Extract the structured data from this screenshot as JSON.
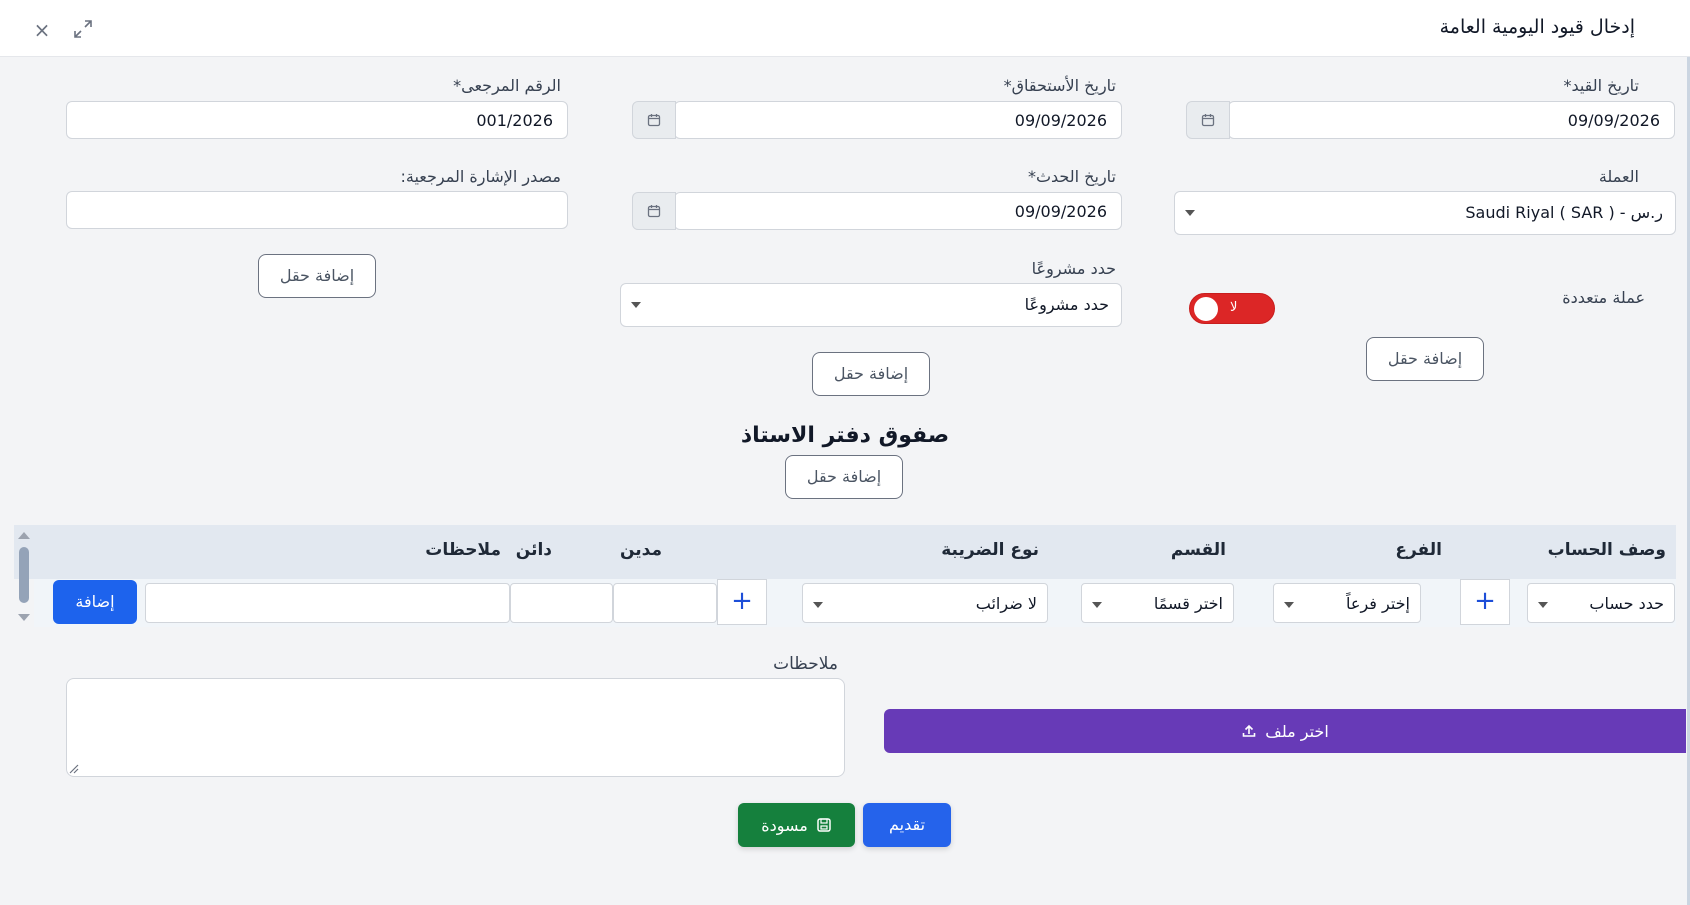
{
  "header": {
    "title": "إدخال قيود اليومية العامة"
  },
  "form": {
    "entry_date": {
      "label": "تاريخ القيد*",
      "value": "09/09/2026"
    },
    "due_date": {
      "label": "تاريخ الأستحقاق*",
      "value": "09/09/2026"
    },
    "reference_number": {
      "label": "الرقم المرجعى*",
      "value": "001/2026"
    },
    "currency": {
      "label": "العملة",
      "value": "ر.س - ( Saudi Riyal ( SAR"
    },
    "event_date": {
      "label": "تاريخ الحدث*",
      "value": "09/09/2026"
    },
    "reference_source": {
      "label": "مصدر الإشارة المرجعية:",
      "value": ""
    },
    "multi_currency": {
      "label": "عملة متعددة",
      "toggle_text": "لا"
    },
    "project": {
      "label": "حدد مشروعًا",
      "value": "حدد مشروعًا"
    },
    "add_field_label": "إضافة حقل"
  },
  "ledger": {
    "title": "صفوق دفتر الاستاذ",
    "columns": {
      "account": "وصف الحساب",
      "branch": "الفرع",
      "department": "القسم",
      "tax_type": "نوع الضريبة",
      "debit": "مدين",
      "credit": "دائن",
      "notes": "ملاحظات"
    },
    "row": {
      "account": "حدد حساب",
      "branch": "إختر فرعاً",
      "department": "اختر قسمًا",
      "tax_type": "لا ضرائب",
      "add_label": "إضافة"
    }
  },
  "notes": {
    "label": "ملاحظات",
    "value": ""
  },
  "file": {
    "label": "اختر ملف"
  },
  "actions": {
    "submit": "تقديم",
    "draft": "مسودة"
  },
  "colors": {
    "primary": "#2563eb",
    "purple": "#673ab7",
    "green": "#15803d",
    "toggle_red": "#dc2626"
  }
}
